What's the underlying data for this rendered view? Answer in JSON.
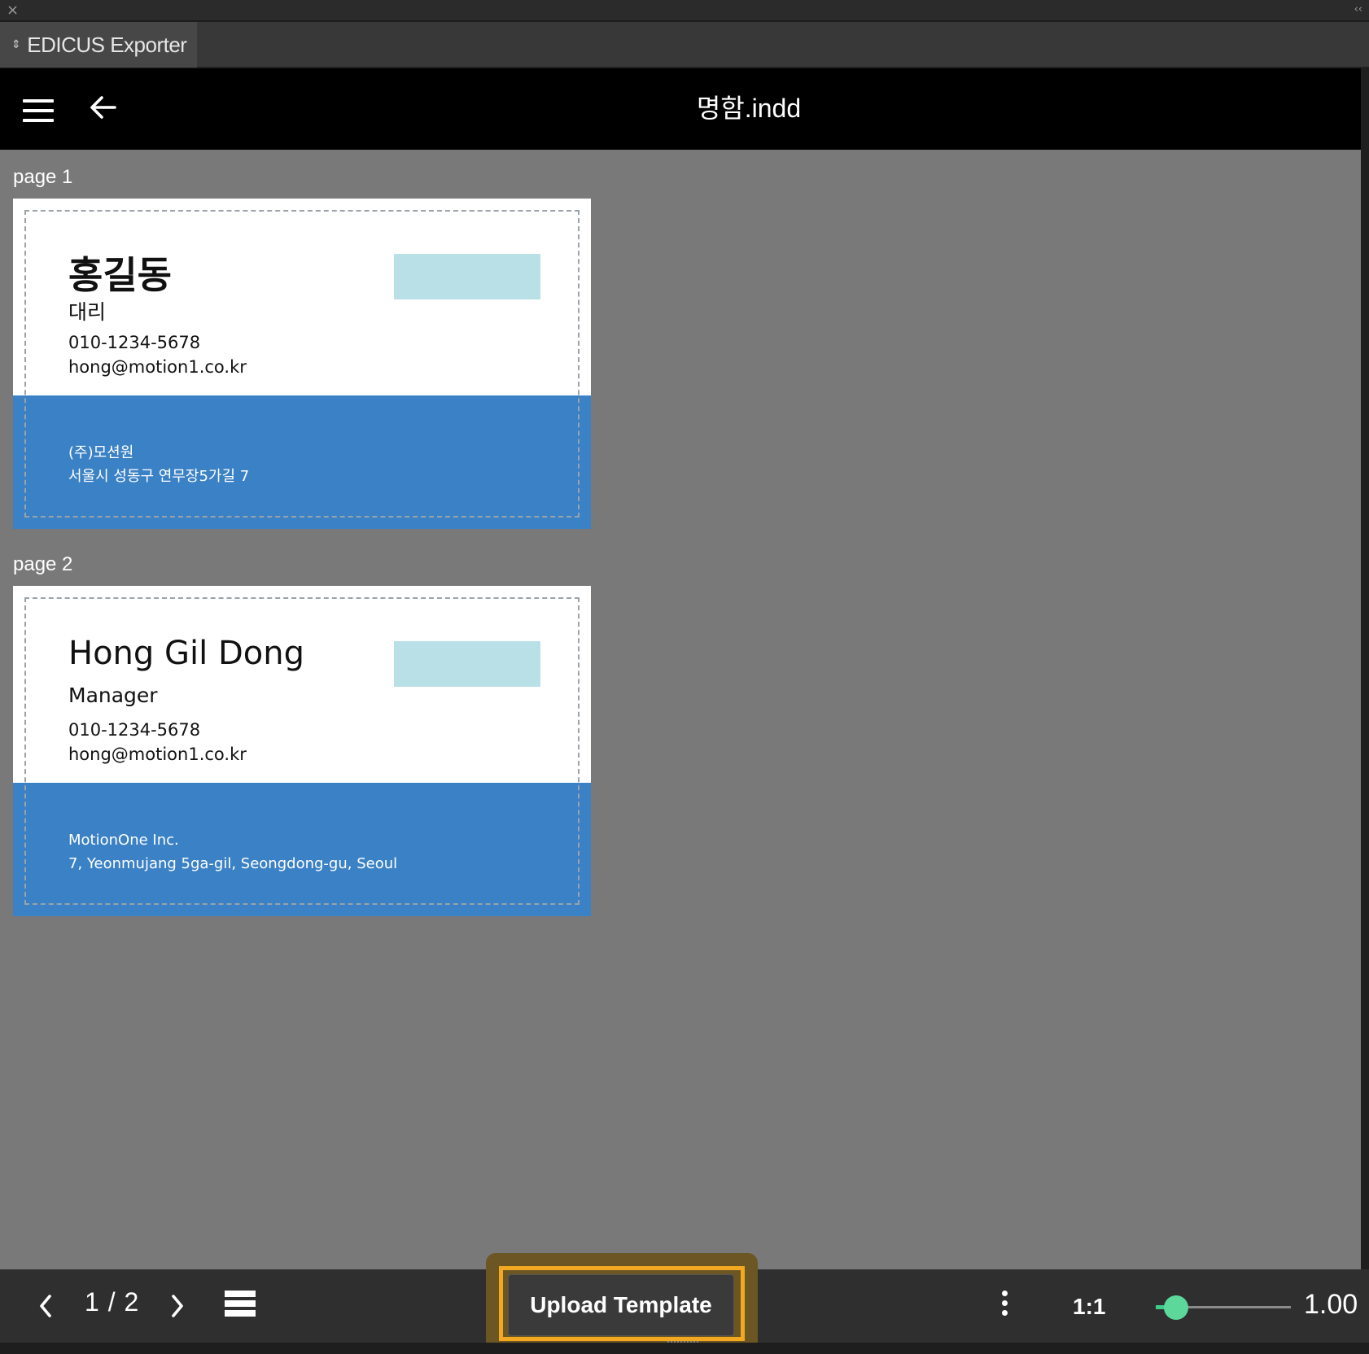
{
  "window": {
    "close_glyph": "×",
    "collapse_glyph": "‹‹"
  },
  "panel_tab": {
    "icon": "updown-icon",
    "label": "EDICUS Exporter"
  },
  "header": {
    "title": "명함.indd"
  },
  "pages": [
    {
      "label": "page 1",
      "name": "홍길동",
      "role": "대리",
      "phone": "010-1234-5678",
      "email": "hong@motion1.co.kr",
      "company": "(주)모션원",
      "address": "서울시 성동구 연무장5가길 7"
    },
    {
      "label": "page 2",
      "name": "Hong Gil Dong",
      "role": "Manager",
      "phone": "010-1234-5678",
      "email": "hong@motion1.co.kr",
      "company": "MotionOne Inc.",
      "address": "7, Yeonmujang 5ga-gil, Seongdong-gu, Seoul"
    }
  ],
  "colors": {
    "band": "#3b81c6",
    "logo_placeholder": "#bae0e7",
    "highlight": "#f3a821",
    "slider_accent": "#5cd99a"
  },
  "footer": {
    "page_indicator": "1 / 2",
    "upload_label": "Upload Template",
    "ratio_label": "1:1",
    "zoom_value": "1.00",
    "zoom_level": 0.15
  }
}
